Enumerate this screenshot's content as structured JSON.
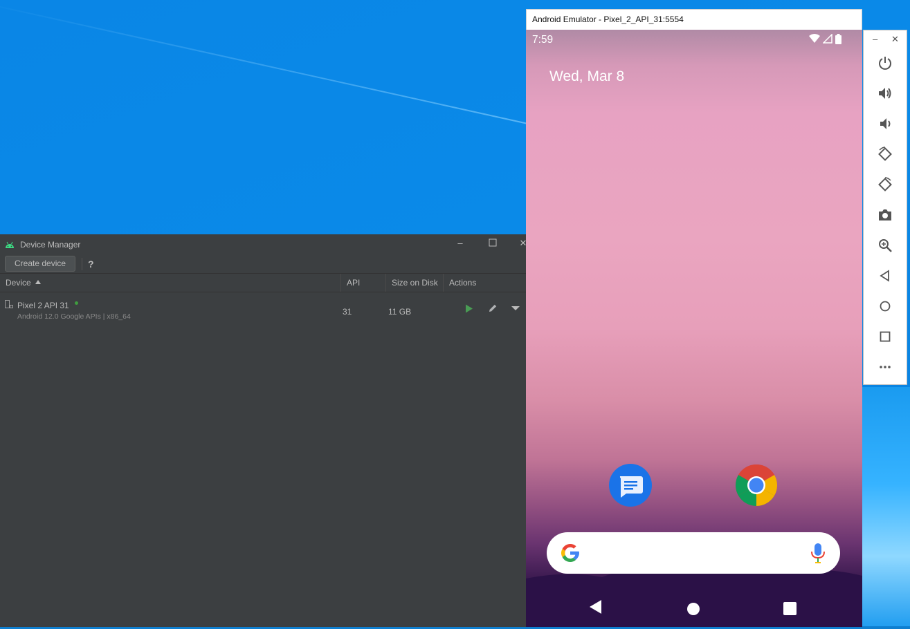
{
  "device_manager": {
    "title": "Device Manager",
    "create_button": "Create device",
    "help_label": "?",
    "columns": {
      "device": "Device",
      "api": "API",
      "size": "Size on Disk",
      "actions": "Actions"
    },
    "rows": [
      {
        "name": "Pixel 2 API 31",
        "subtitle": "Android 12.0 Google APIs | x86_64",
        "api": "31",
        "size": "11 GB"
      }
    ]
  },
  "emulator": {
    "title": "Android Emulator - Pixel_2_API_31:5554",
    "status_time": "7:59",
    "date": "Wed, Mar 8",
    "apps": [
      "messages-app",
      "chrome-app"
    ],
    "toolbar": [
      "power-icon",
      "volume-up-icon",
      "volume-down-icon",
      "rotate-left-icon",
      "rotate-right-icon",
      "camera-icon",
      "zoom-icon",
      "back-icon",
      "home-icon",
      "overview-icon",
      "more-icon"
    ]
  },
  "colors": {
    "ide_background": "#3c3f41",
    "desktop_blue": "#0a86e6",
    "run_green": "#499c54",
    "accent_blue": "#1a73e8"
  }
}
